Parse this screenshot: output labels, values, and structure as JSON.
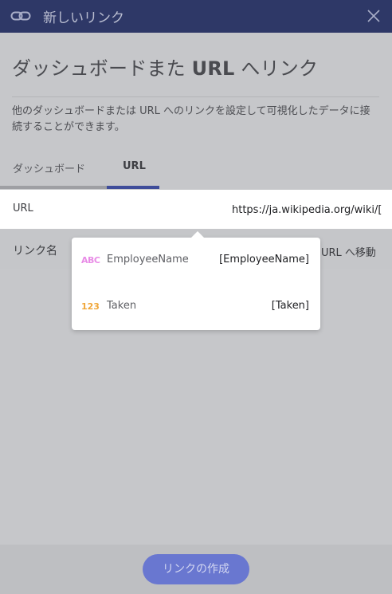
{
  "dialog": {
    "title": "新しいリンク",
    "heading_prefix": "ダッシュボードまた ",
    "heading_bold": "URL",
    "heading_suffix": " へリンク",
    "description": "他のダッシュボードまたは URL へのリンクを設定して可視化したデータに接続することができます。"
  },
  "tabs": [
    {
      "label": "ダッシュボード",
      "active": false
    },
    {
      "label": "URL",
      "active": true
    }
  ],
  "form": {
    "url_label": "URL",
    "url_value": "https://ja.wikipedia.org/wiki/[",
    "link_name_label": "リンク名",
    "link_action": "URL へ移動"
  },
  "autocomplete": {
    "items": [
      {
        "type_icon": "ABC",
        "name": "EmployeeName",
        "token": "[EmployeeName]"
      },
      {
        "type_icon": "123",
        "name": "Taken",
        "token": "[Taken]"
      }
    ]
  },
  "footer": {
    "create_button": "リンクの作成"
  },
  "colors": {
    "titlebar": "#2e3867",
    "accent": "#3f4d9a",
    "button": "#6977d0",
    "text_type": "#e88be6",
    "number_type": "#f0a73a"
  },
  "icons": {
    "title_icon": "link-icon",
    "close_icon": "close-icon"
  }
}
